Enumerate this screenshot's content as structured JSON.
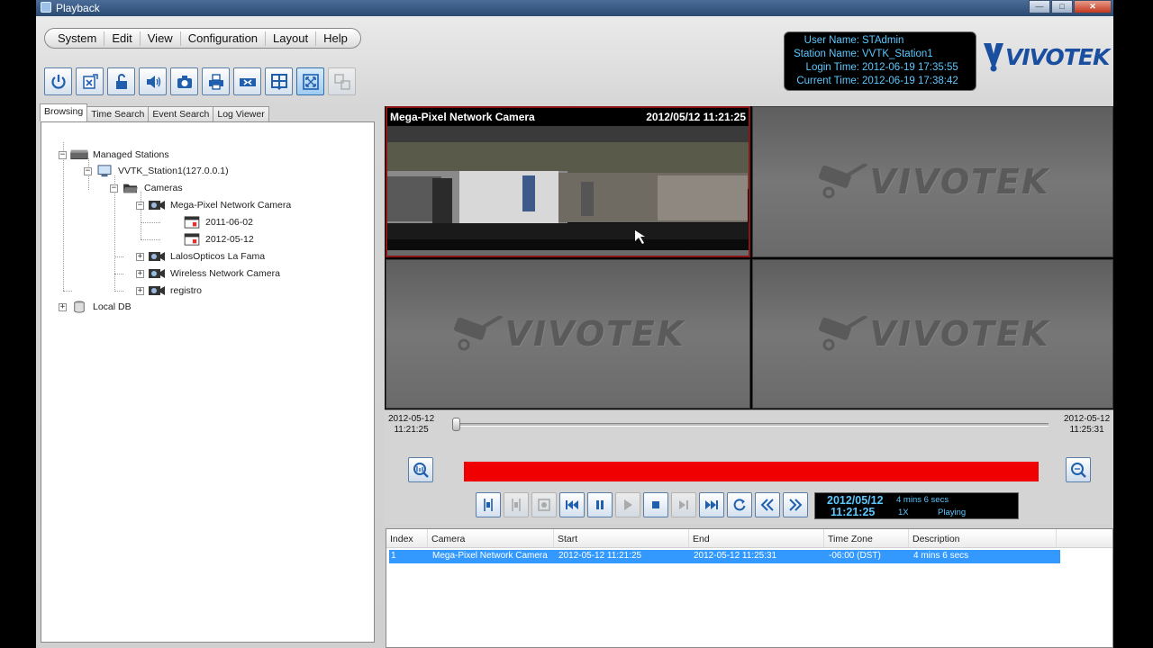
{
  "window": {
    "title": "Playback"
  },
  "menu": [
    "System",
    "Edit",
    "View",
    "Configuration",
    "Layout",
    "Help"
  ],
  "toolbar": [
    {
      "icon": "power-icon",
      "state": "normal"
    },
    {
      "icon": "export-excel-icon",
      "state": "normal"
    },
    {
      "icon": "unlock-icon",
      "state": "normal"
    },
    {
      "icon": "speaker-icon",
      "state": "normal"
    },
    {
      "icon": "camera-snapshot-icon",
      "state": "normal"
    },
    {
      "icon": "printer-icon",
      "state": "normal"
    },
    {
      "icon": "sync-icon",
      "state": "normal"
    },
    {
      "icon": "layout-grid-icon",
      "state": "normal"
    },
    {
      "icon": "fullscreen-icon",
      "state": "active"
    },
    {
      "icon": "multi-window-icon",
      "state": "disabled"
    }
  ],
  "info": {
    "user_label": "User Name:",
    "user": "STAdmin",
    "station_label": "Station Name:",
    "station": "VVTK_Station1",
    "login_label": "Login Time:",
    "login": "2012-06-19 17:35:55",
    "current_label": "Current Time:",
    "current": "2012-06-19 17:38:42"
  },
  "brand": "VIVOTEK",
  "tabs": [
    "Browsing",
    "Time Search",
    "Event Search",
    "Log Viewer"
  ],
  "tree": {
    "managed": "Managed Stations",
    "station": "VVTK_Station1(127.0.0.1)",
    "cameras": "Cameras",
    "cam1": "Mega-Pixel Network Camera",
    "date1": "2011-06-02",
    "date2": "2012-05-12",
    "cam2": "LalosOpticos La Fama",
    "cam3": "Wireless Network Camera",
    "cam4": "registro",
    "localdb": "Local DB"
  },
  "video": {
    "cam_name": "Mega-Pixel Network Camera",
    "cam_timestamp": "2012/05/12 11:21:25",
    "watermark": "VIVOTEK"
  },
  "timeline": {
    "start_date": "2012-05-12",
    "start_time": "11:21:25",
    "end_date": "2012-05-12",
    "end_time": "11:25:31",
    "position": 0.0
  },
  "playback": {
    "date": "2012/05/12",
    "time": "11:21:25",
    "duration": "4 mins 6 secs",
    "speed": "1X",
    "state": "Playing"
  },
  "results": {
    "headers": [
      "Index",
      "Camera",
      "Start",
      "End",
      "Time Zone",
      "Description"
    ],
    "rows": [
      [
        "1",
        "Mega-Pixel Network Camera",
        "2012-05-12 11:21:25",
        "2012-05-12 11:25:31",
        "-06:00 (DST)",
        "4 mins 6 secs"
      ]
    ]
  },
  "colors": {
    "accent": "#3399ff",
    "timeline_bar": "#f00000",
    "info_text": "#5cc8ff",
    "brand": "#1a4fa0"
  }
}
